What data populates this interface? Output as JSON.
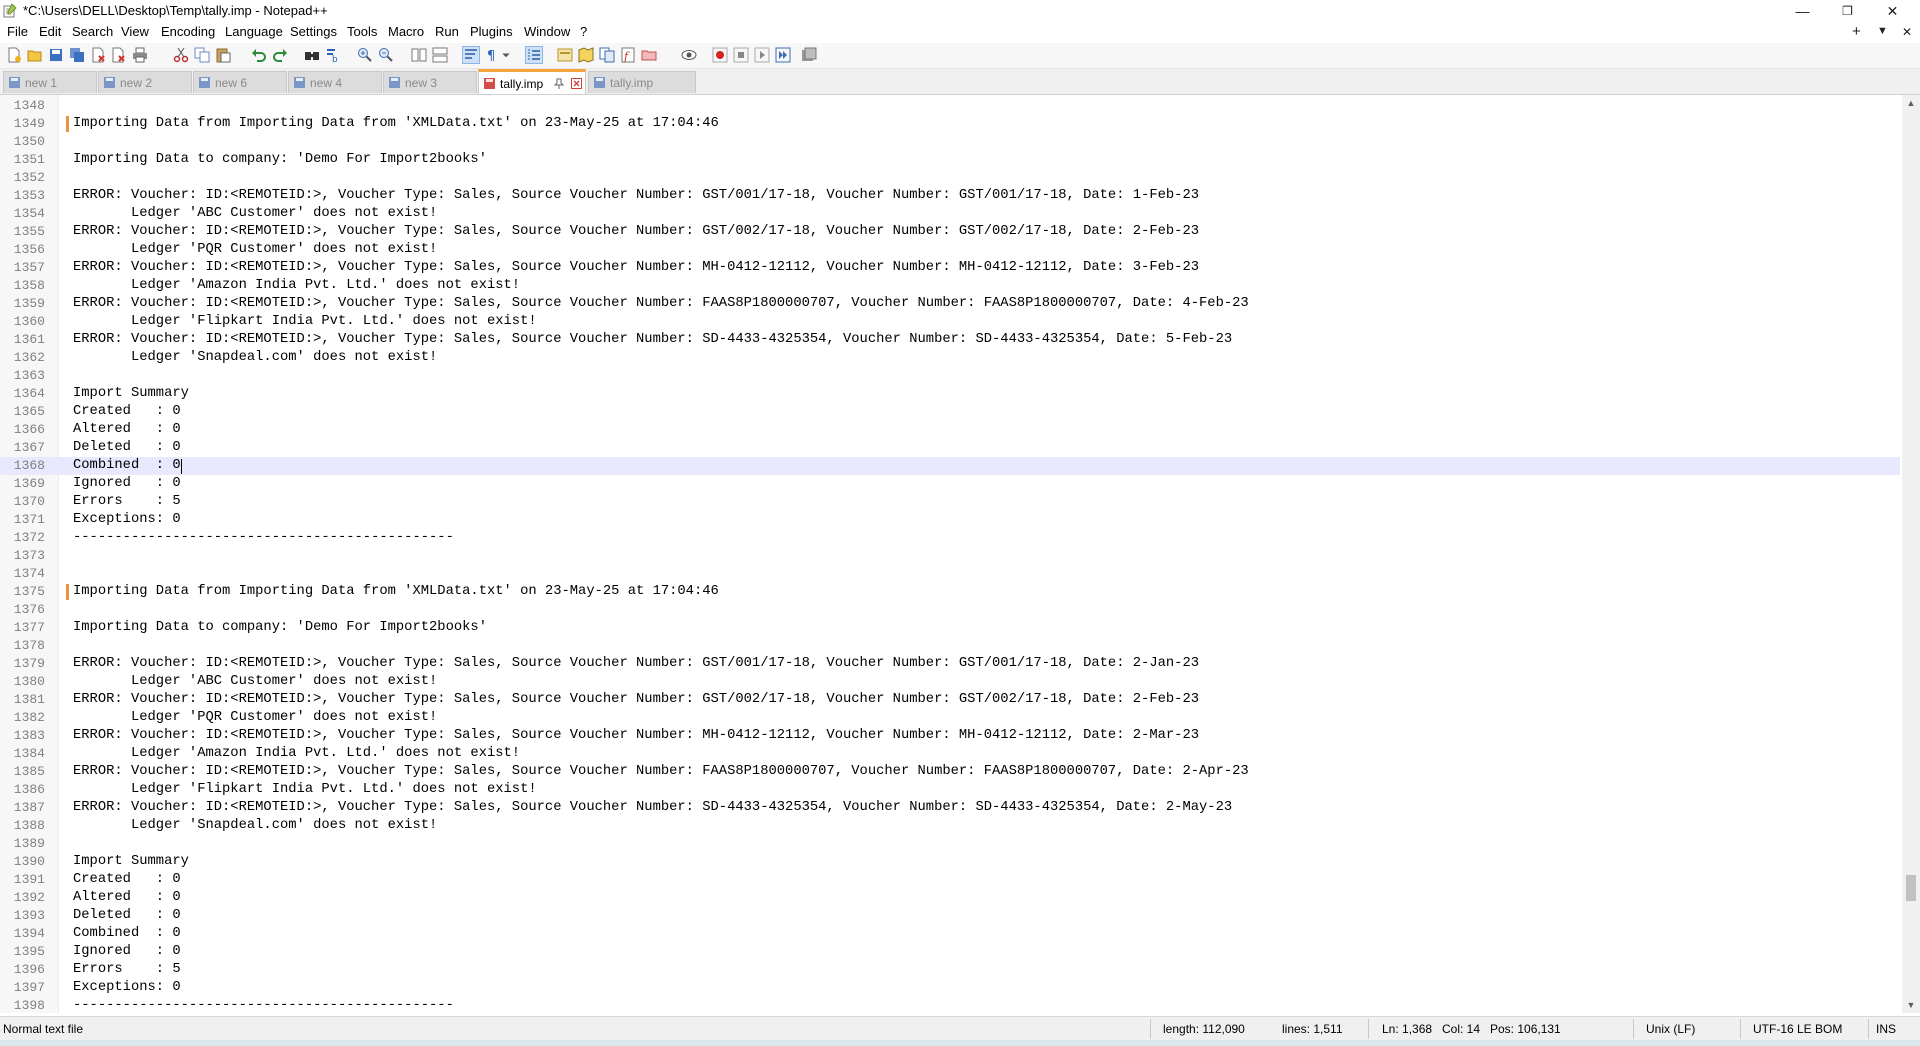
{
  "window": {
    "title": "*C:\\Users\\DELL\\Desktop\\Temp\\tally.imp - Notepad++",
    "controls": {
      "minimize": "—",
      "restore": "❐",
      "close": "✕"
    }
  },
  "menu": {
    "items": [
      "File",
      "Edit",
      "Search",
      "View",
      "Encoding",
      "Language",
      "Settings",
      "Tools",
      "Macro",
      "Run",
      "Plugins",
      "Window",
      "?"
    ],
    "right": {
      "new_tab": "+",
      "list": "▼",
      "close": "✕"
    }
  },
  "tabs": [
    {
      "label": "new 1",
      "state": "saved"
    },
    {
      "label": "new 2",
      "state": "saved"
    },
    {
      "label": "new 6",
      "state": "saved"
    },
    {
      "label": "new 4",
      "state": "saved"
    },
    {
      "label": "new 3",
      "state": "saved"
    },
    {
      "label": "tally.imp",
      "state": "active-modified"
    },
    {
      "label": "tally.imp",
      "state": "saved"
    }
  ],
  "editor": {
    "current_line": 1368,
    "lines": [
      {
        "n": "1348",
        "t": ""
      },
      {
        "n": "1349",
        "t": "Importing Data from Importing Data from 'XMLData.txt' on 23-May-25 at 17:04:46",
        "mark": true
      },
      {
        "n": "1350",
        "t": ""
      },
      {
        "n": "1351",
        "t": "Importing Data to company: 'Demo For Import2books'"
      },
      {
        "n": "1352",
        "t": ""
      },
      {
        "n": "1353",
        "t": "ERROR: Voucher: ID:<REMOTEID:>, Voucher Type: Sales, Source Voucher Number: GST/001/17-18, Voucher Number: GST/001/17-18, Date: 1-Feb-23"
      },
      {
        "n": "1354",
        "t": "       Ledger 'ABC Customer' does not exist!"
      },
      {
        "n": "1355",
        "t": "ERROR: Voucher: ID:<REMOTEID:>, Voucher Type: Sales, Source Voucher Number: GST/002/17-18, Voucher Number: GST/002/17-18, Date: 2-Feb-23"
      },
      {
        "n": "1356",
        "t": "       Ledger 'PQR Customer' does not exist!"
      },
      {
        "n": "1357",
        "t": "ERROR: Voucher: ID:<REMOTEID:>, Voucher Type: Sales, Source Voucher Number: MH-0412-12112, Voucher Number: MH-0412-12112, Date: 3-Feb-23"
      },
      {
        "n": "1358",
        "t": "       Ledger 'Amazon India Pvt. Ltd.' does not exist!"
      },
      {
        "n": "1359",
        "t": "ERROR: Voucher: ID:<REMOTEID:>, Voucher Type: Sales, Source Voucher Number: FAAS8P1800000707, Voucher Number: FAAS8P1800000707, Date: 4-Feb-23"
      },
      {
        "n": "1360",
        "t": "       Ledger 'Flipkart India Pvt. Ltd.' does not exist!"
      },
      {
        "n": "1361",
        "t": "ERROR: Voucher: ID:<REMOTEID:>, Voucher Type: Sales, Source Voucher Number: SD-4433-4325354, Voucher Number: SD-4433-4325354, Date: 5-Feb-23"
      },
      {
        "n": "1362",
        "t": "       Ledger 'Snapdeal.com' does not exist!"
      },
      {
        "n": "1363",
        "t": ""
      },
      {
        "n": "1364",
        "t": "Import Summary"
      },
      {
        "n": "1365",
        "t": "Created   : 0"
      },
      {
        "n": "1366",
        "t": "Altered   : 0"
      },
      {
        "n": "1367",
        "t": "Deleted   : 0"
      },
      {
        "n": "1368",
        "t": "Combined  : 0",
        "current": true
      },
      {
        "n": "1369",
        "t": "Ignored   : 0"
      },
      {
        "n": "1370",
        "t": "Errors    : 5"
      },
      {
        "n": "1371",
        "t": "Exceptions: 0"
      },
      {
        "n": "1372",
        "t": "----------------------------------------------"
      },
      {
        "n": "1373",
        "t": ""
      },
      {
        "n": "1374",
        "t": ""
      },
      {
        "n": "1375",
        "t": "Importing Data from Importing Data from 'XMLData.txt' on 23-May-25 at 17:04:46",
        "mark": true
      },
      {
        "n": "1376",
        "t": ""
      },
      {
        "n": "1377",
        "t": "Importing Data to company: 'Demo For Import2books'"
      },
      {
        "n": "1378",
        "t": ""
      },
      {
        "n": "1379",
        "t": "ERROR: Voucher: ID:<REMOTEID:>, Voucher Type: Sales, Source Voucher Number: GST/001/17-18, Voucher Number: GST/001/17-18, Date: 2-Jan-23"
      },
      {
        "n": "1380",
        "t": "       Ledger 'ABC Customer' does not exist!"
      },
      {
        "n": "1381",
        "t": "ERROR: Voucher: ID:<REMOTEID:>, Voucher Type: Sales, Source Voucher Number: GST/002/17-18, Voucher Number: GST/002/17-18, Date: 2-Feb-23"
      },
      {
        "n": "1382",
        "t": "       Ledger 'PQR Customer' does not exist!"
      },
      {
        "n": "1383",
        "t": "ERROR: Voucher: ID:<REMOTEID:>, Voucher Type: Sales, Source Voucher Number: MH-0412-12112, Voucher Number: MH-0412-12112, Date: 2-Mar-23"
      },
      {
        "n": "1384",
        "t": "       Ledger 'Amazon India Pvt. Ltd.' does not exist!"
      },
      {
        "n": "1385",
        "t": "ERROR: Voucher: ID:<REMOTEID:>, Voucher Type: Sales, Source Voucher Number: FAAS8P1800000707, Voucher Number: FAAS8P1800000707, Date: 2-Apr-23"
      },
      {
        "n": "1386",
        "t": "       Ledger 'Flipkart India Pvt. Ltd.' does not exist!"
      },
      {
        "n": "1387",
        "t": "ERROR: Voucher: ID:<REMOTEID:>, Voucher Type: Sales, Source Voucher Number: SD-4433-4325354, Voucher Number: SD-4433-4325354, Date: 2-May-23"
      },
      {
        "n": "1388",
        "t": "       Ledger 'Snapdeal.com' does not exist!"
      },
      {
        "n": "1389",
        "t": ""
      },
      {
        "n": "1390",
        "t": "Import Summary"
      },
      {
        "n": "1391",
        "t": "Created   : 0"
      },
      {
        "n": "1392",
        "t": "Altered   : 0"
      },
      {
        "n": "1393",
        "t": "Deleted   : 0"
      },
      {
        "n": "1394",
        "t": "Combined  : 0"
      },
      {
        "n": "1395",
        "t": "Ignored   : 0"
      },
      {
        "n": "1396",
        "t": "Errors    : 5"
      },
      {
        "n": "1397",
        "t": "Exceptions: 0"
      },
      {
        "n": "1398",
        "t": "----------------------------------------------"
      }
    ]
  },
  "status": {
    "file_type": "Normal text file",
    "length": "length: 112,090",
    "lines": "lines: 1,511",
    "ln": "Ln: 1,368",
    "col": "Col: 14",
    "pos": "Pos: 106,131",
    "eol": "Unix (LF)",
    "encoding": "UTF-16 LE BOM",
    "mode": "INS"
  },
  "colors": {
    "active_tab_accent": "#f6a33a",
    "change_marker": "#f0923b",
    "current_line": "#e8e8ff",
    "line_number": "#808080"
  }
}
